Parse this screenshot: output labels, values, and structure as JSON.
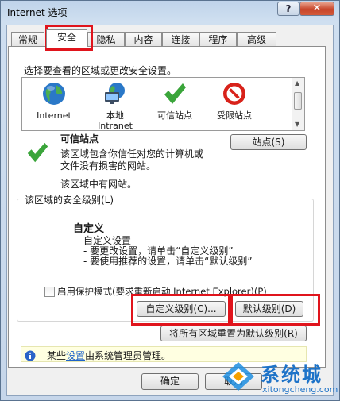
{
  "window": {
    "title": "Internet 选项",
    "help_label": "?",
    "close_label": "✕"
  },
  "tabs": [
    "常规",
    "安全",
    "隐私",
    "内容",
    "连接",
    "程序",
    "高级"
  ],
  "security": {
    "zone_prompt": "选择要查看的区域或更改安全设置。",
    "zones": [
      {
        "line1": "Internet",
        "line2": "",
        "icon": "globe-icon"
      },
      {
        "line1": "本地",
        "line2": "Intranet",
        "icon": "intranet-computer-icon"
      },
      {
        "line1": "可信站点",
        "line2": "",
        "icon": "green-check-icon"
      },
      {
        "line1": "受限站点",
        "line2": "",
        "icon": "no-entry-icon"
      }
    ],
    "selected_zone": {
      "name": "可信站点",
      "desc_line1": "该区域包含你信任对您的计算机或",
      "desc_line2": "文件没有损害的网站。",
      "status": "该区域中有网站。",
      "sites_button": "站点(S)"
    },
    "level": {
      "group_label": "该区域的安全级别(L)",
      "title": "自定义",
      "line1": "自定义设置",
      "line2": "- 要更改设置，请单击“自定义级别”",
      "line3": "- 要使用推荐的设置，请单击“默认级别”",
      "protected_mode": "启用保护模式(要求重新启动 Internet Explorer)(P)",
      "protected_mode_checked": false,
      "custom_button": "自定义级别(C)...",
      "default_button": "默认级别(D)",
      "reset_all_button": "将所有区域重置为默认级别(R)"
    },
    "admin_notice": {
      "prefix": "某些",
      "link": "设置",
      "suffix": "由系统管理员管理。"
    }
  },
  "footer": {
    "ok": "确定",
    "cancel": "取消"
  },
  "watermark": {
    "brand": "系统城",
    "url": "xitongcheng.com"
  },
  "colors": {
    "highlight_red": "#e0141c",
    "accent_blue": "#1e73c8",
    "check_green": "#3aa53a"
  }
}
